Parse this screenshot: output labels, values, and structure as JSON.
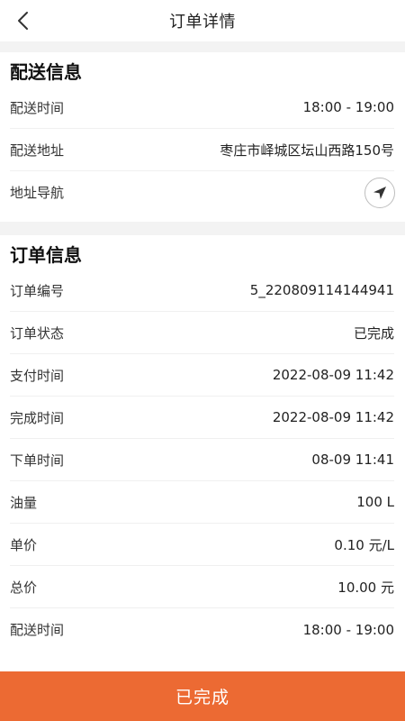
{
  "header": {
    "title": "订单详情",
    "back_icon": "chevron-left-icon"
  },
  "delivery": {
    "title": "配送信息",
    "time_label": "配送时间",
    "time_value": "18:00 - 19:00",
    "address_label": "配送地址",
    "address_value": "枣庄市峄城区坛山西路150号",
    "nav_label": "地址导航",
    "nav_icon": "navigation-arrow-icon"
  },
  "order": {
    "title": "订单信息",
    "rows": [
      {
        "label": "订单编号",
        "value": "5_220809114144941"
      },
      {
        "label": "订单状态",
        "value": "已完成"
      },
      {
        "label": "支付时间",
        "value": "2022-08-09 11:42"
      },
      {
        "label": "完成时间",
        "value": "2022-08-09 11:42"
      },
      {
        "label": "下单时间",
        "value": "08-09 11:41"
      },
      {
        "label": "油量",
        "value": "100 L"
      },
      {
        "label": "单价",
        "value": "0.10 元/L"
      },
      {
        "label": "总价",
        "value": "10.00 元"
      },
      {
        "label": "配送时间",
        "value": "18:00 - 19:00"
      }
    ]
  },
  "footer": {
    "status_label": "已完成"
  },
  "colors": {
    "accent": "#ec6a33",
    "divider": "#f3f3f3"
  }
}
